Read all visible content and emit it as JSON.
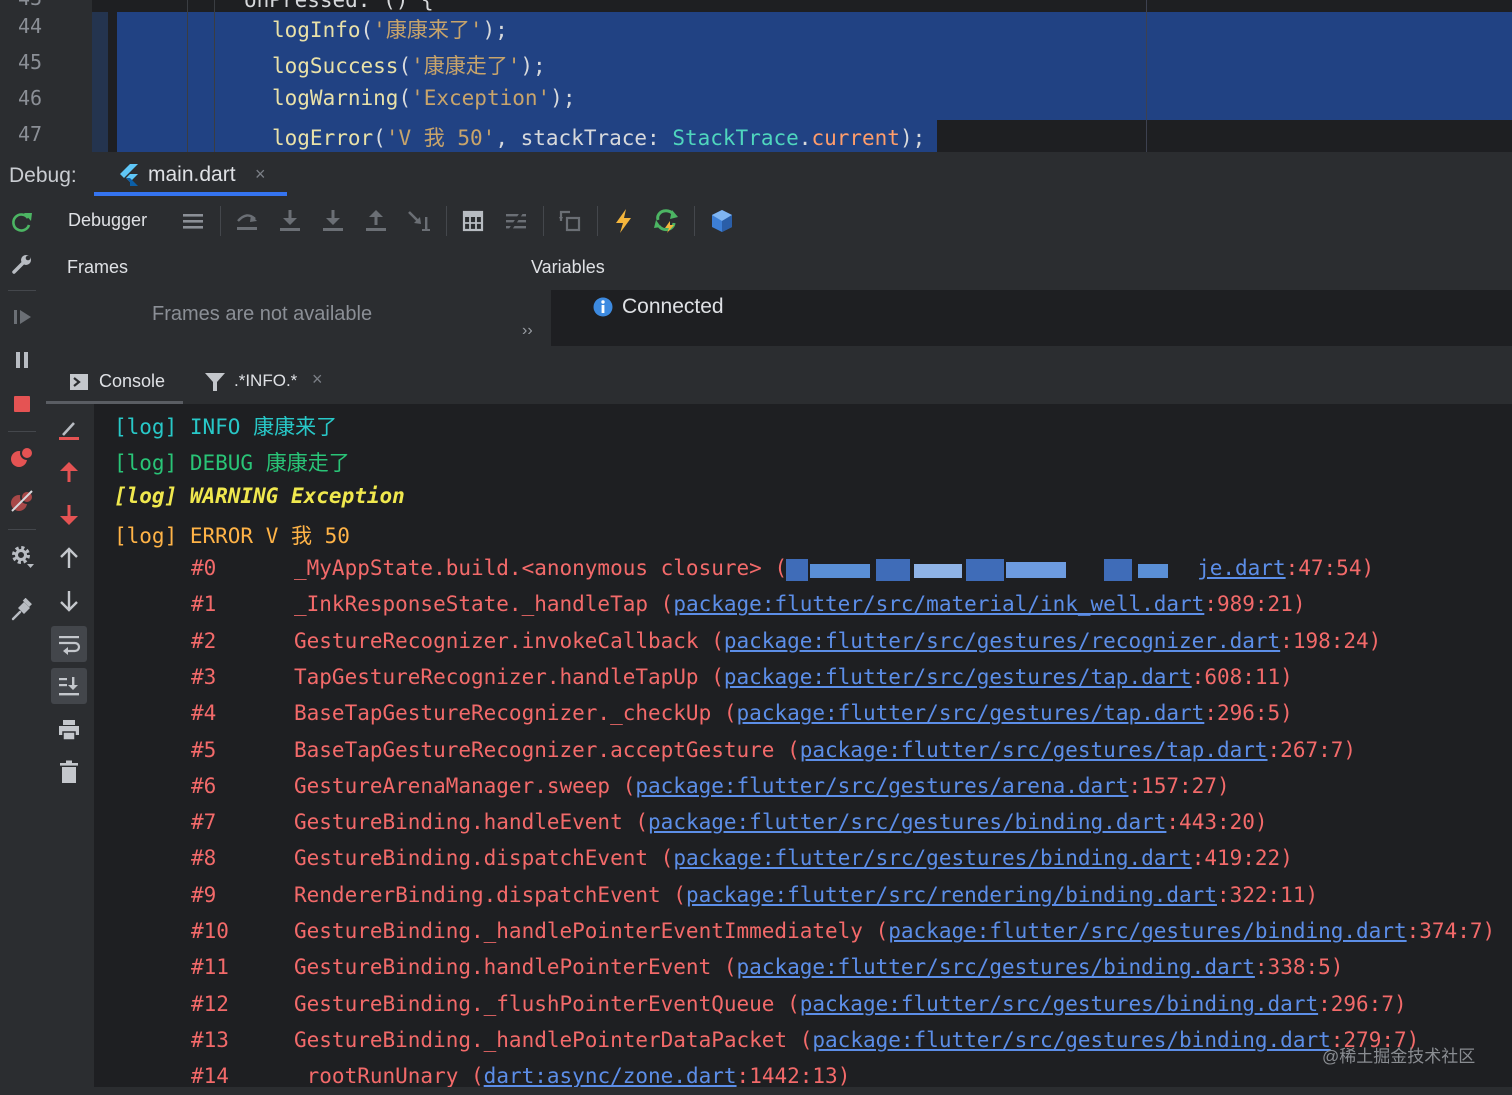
{
  "editor": {
    "top_partial": "onPressed: () {",
    "lines": [
      {
        "num": "44",
        "parts": [
          {
            "t": "logInfo",
            "c": "fn"
          },
          {
            "t": "(",
            "c": "pl"
          },
          {
            "t": "'康康来了'",
            "c": "str"
          },
          {
            "t": ");",
            "c": "pl"
          }
        ]
      },
      {
        "num": "45",
        "parts": [
          {
            "t": "logSuccess",
            "c": "fn"
          },
          {
            "t": "(",
            "c": "pl"
          },
          {
            "t": "'康康走了'",
            "c": "str"
          },
          {
            "t": ");",
            "c": "pl"
          }
        ]
      },
      {
        "num": "46",
        "parts": [
          {
            "t": "logWarning",
            "c": "fn"
          },
          {
            "t": "(",
            "c": "pl"
          },
          {
            "t": "'Exception'",
            "c": "str"
          },
          {
            "t": ");",
            "c": "pl"
          }
        ]
      },
      {
        "num": "47",
        "parts": [
          {
            "t": "logError",
            "c": "fn"
          },
          {
            "t": "(",
            "c": "pl"
          },
          {
            "t": "'V 我 50'",
            "c": "str"
          },
          {
            "t": ", stackTrace: ",
            "c": "pl"
          },
          {
            "t": "StackTrace",
            "c": "cls"
          },
          {
            "t": ".",
            "c": "pl"
          },
          {
            "t": "current",
            "c": "cur"
          },
          {
            "t": ");",
            "c": "pl"
          }
        ]
      }
    ]
  },
  "debug": {
    "label": "Debug:",
    "tab": {
      "label": "main.dart",
      "close": "×"
    }
  },
  "toolbar": {
    "debugger_label": "Debugger"
  },
  "frames": {
    "header": "Frames",
    "empty": "Frames are not available",
    "more": "››"
  },
  "variables": {
    "header": "Variables",
    "status": "Connected"
  },
  "console": {
    "tab_label": "Console",
    "filter_label": ".*INFO.*",
    "filter_close": "×",
    "logs": [
      {
        "text": "[log] INFO 康康来了",
        "level": "info"
      },
      {
        "text": "[log] DEBUG 康康走了",
        "level": "debug"
      },
      {
        "text": "[log] WARNING Exception",
        "level": "warn"
      },
      {
        "text": "[log] ERROR V 我 50",
        "level": "error"
      }
    ],
    "frames": [
      {
        "num": "#0",
        "method": "_MyAppState.build.<anonymous closure>",
        "link": "",
        "loc": "je.dart",
        "pos": ":47:54)"
      },
      {
        "num": "#1",
        "method": "_InkResponseState._handleTap",
        "link": "package:flutter/src/material/ink_well.dart",
        "pos": ":989:21)"
      },
      {
        "num": "#2",
        "method": "GestureRecognizer.invokeCallback",
        "link": "package:flutter/src/gestures/recognizer.dart",
        "pos": ":198:24)"
      },
      {
        "num": "#3",
        "method": "TapGestureRecognizer.handleTapUp",
        "link": "package:flutter/src/gestures/tap.dart",
        "pos": ":608:11)"
      },
      {
        "num": "#4",
        "method": "BaseTapGestureRecognizer._checkUp",
        "link": "package:flutter/src/gestures/tap.dart",
        "pos": ":296:5)"
      },
      {
        "num": "#5",
        "method": "BaseTapGestureRecognizer.acceptGesture",
        "link": "package:flutter/src/gestures/tap.dart",
        "pos": ":267:7)"
      },
      {
        "num": "#6",
        "method": "GestureArenaManager.sweep",
        "link": "package:flutter/src/gestures/arena.dart",
        "pos": ":157:27)"
      },
      {
        "num": "#7",
        "method": "GestureBinding.handleEvent",
        "link": "package:flutter/src/gestures/binding.dart",
        "pos": ":443:20)"
      },
      {
        "num": "#8",
        "method": "GestureBinding.dispatchEvent",
        "link": "package:flutter/src/gestures/binding.dart",
        "pos": ":419:22)"
      },
      {
        "num": "#9",
        "method": "RendererBinding.dispatchEvent",
        "link": "package:flutter/src/rendering/binding.dart",
        "pos": ":322:11)"
      },
      {
        "num": "#10",
        "method": "GestureBinding._handlePointerEventImmediately",
        "link": "package:flutter/src/gestures/binding.dart",
        "pos": ":374:7)"
      },
      {
        "num": "#11",
        "method": "GestureBinding.handlePointerEvent",
        "link": "package:flutter/src/gestures/binding.dart",
        "pos": ":338:5)"
      },
      {
        "num": "#12",
        "method": "GestureBinding._flushPointerEventQueue",
        "link": "package:flutter/src/gestures/binding.dart",
        "pos": ":296:7)"
      },
      {
        "num": "#13",
        "method": "GestureBinding._handlePointerDataPacket",
        "link": "package:flutter/src/gestures/binding.dart",
        "pos": ":279:7)"
      },
      {
        "num": "#14",
        "method": "_rootRunUnary",
        "link": "dart:async/zone.dart",
        "pos": ":1442:13)"
      }
    ]
  },
  "watermark": "@稀土掘金技术社区",
  "colors": {
    "accent": "#3574f0",
    "selection": "#214283",
    "error": "#f36a6a",
    "link": "#5c8ee8",
    "info": "#28c8c8",
    "debug": "#29c477",
    "warning": "#f0e84e"
  },
  "icons": {
    "left_column": [
      "rerun-icon",
      "wrench-icon",
      "resume-icon",
      "pause-icon",
      "stop-icon",
      "breakpoints-icon",
      "mute-breakpoints-icon",
      "settings-icon",
      "pin-icon"
    ],
    "toolbar": [
      "menu-icon",
      "step-over-icon",
      "step-into-icon",
      "force-step-into-icon",
      "step-out-icon",
      "run-to-cursor-icon",
      "evaluate-icon",
      "trace-icon",
      "drop-frame-icon",
      "hot-reload-icon",
      "hot-restart-icon",
      "devtools-icon"
    ],
    "console": [
      "clear-icon",
      "up-arrow-icon",
      "down-arrow-icon",
      "up-stack-icon",
      "down-stack-icon",
      "soft-wrap-icon",
      "scroll-end-icon",
      "print-icon",
      "trash-icon"
    ]
  }
}
